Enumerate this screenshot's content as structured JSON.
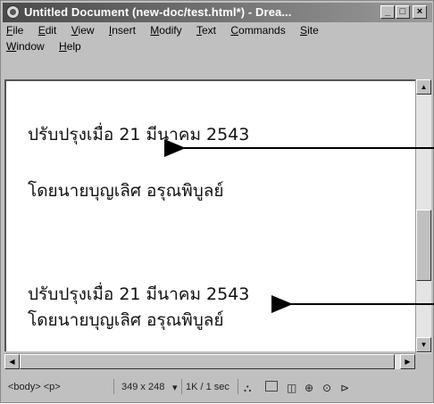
{
  "window": {
    "title": "Untitled Document (new-doc/test.html*) - Drea..."
  },
  "menu": {
    "row1": [
      "File",
      "Edit",
      "View",
      "Insert",
      "Modify",
      "Text",
      "Commands",
      "Site"
    ],
    "row2": [
      "Window",
      "Help"
    ]
  },
  "document": {
    "lines": [
      "ปรับปรุงเมื่อ 21 มีนาคม 2543",
      "โดยนายบุญเลิศ อรุณพิบูลย์",
      "ปรับปรุงเมื่อ 21 มีนาคม 2543",
      "โดยนายบุญเลิศ อรุณพิบูลย์"
    ]
  },
  "statusbar": {
    "tags": "<body> <p>",
    "window_size": "349 x 248",
    "size_dropdown_arrow": "▾",
    "download_stats": "1K / 1 sec"
  },
  "icons": {
    "app": "dreamweaver-app-icon",
    "minimize": "minimize-icon",
    "maximize": "maximize-icon",
    "close": "close-icon"
  }
}
